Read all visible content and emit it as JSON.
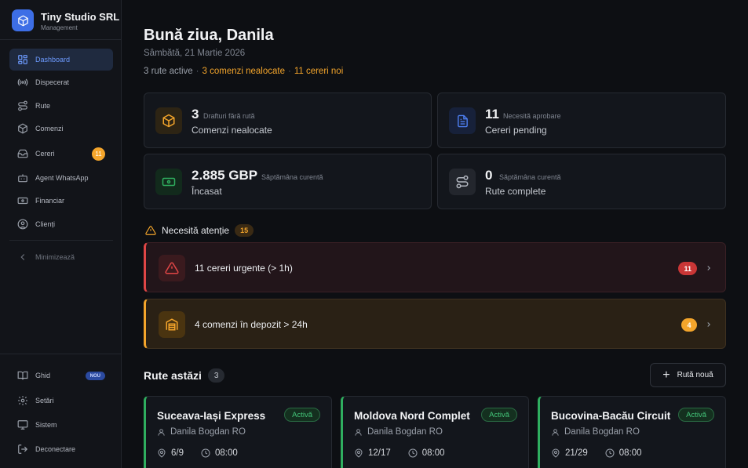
{
  "brand": {
    "name": "Tiny Studio SRL",
    "subtitle": "Management"
  },
  "sidebar": {
    "items": [
      {
        "label": "Dashboard",
        "icon": "grid-icon",
        "active": true
      },
      {
        "label": "Dispecerat",
        "icon": "broadcast-icon"
      },
      {
        "label": "Rute",
        "icon": "route-icon"
      },
      {
        "label": "Comenzi",
        "icon": "package-icon"
      },
      {
        "label": "Cereri",
        "icon": "inbox-icon",
        "badge": "11"
      },
      {
        "label": "Agent WhatsApp",
        "icon": "bot-icon"
      },
      {
        "label": "Financiar",
        "icon": "banknote-icon"
      },
      {
        "label": "Clienți",
        "icon": "user-circle-icon"
      }
    ],
    "collapse_label": "Minimizează",
    "bottom_items": [
      {
        "label": "Ghid",
        "icon": "book-icon",
        "badge": "NOU"
      },
      {
        "label": "Setări",
        "icon": "gear-icon"
      },
      {
        "label": "Sistem",
        "icon": "monitor-icon"
      },
      {
        "label": "Deconectare",
        "icon": "logout-icon"
      }
    ]
  },
  "header": {
    "greeting": "Bună ziua, Danila",
    "date": "Sâmbătă, 21 Martie 2026",
    "summary": {
      "routes": "3 rute active",
      "orders": "3 comenzi nealocate",
      "requests": "11 cereri noi",
      "separator": "·"
    }
  },
  "stats": [
    {
      "value": "3",
      "sub": "Drafturi fără rută",
      "title": "Comenzi nealocate",
      "icon": "package-icon",
      "color": "#f4a52b"
    },
    {
      "value": "11",
      "sub": "Necesită aprobare",
      "title": "Cereri pending",
      "icon": "file-icon",
      "color": "#4d7ef0"
    },
    {
      "value": "2.885 GBP",
      "sub": "Săptămâna curentă",
      "title": "Încasat",
      "icon": "banknote-icon",
      "color": "#2fae5f"
    },
    {
      "value": "0",
      "sub": "Săptămâna curentă",
      "title": "Rute complete",
      "icon": "route-icon",
      "color": "#9aa0aa"
    }
  ],
  "attention": {
    "title": "Necesită atenție",
    "count": "15",
    "alerts": [
      {
        "text": "11 cereri urgente (> 1h)",
        "count": "11",
        "icon": "alert-triangle-icon",
        "color": "#e04646"
      },
      {
        "text": "4 comenzi în depozit > 24h",
        "count": "4",
        "icon": "warehouse-icon",
        "color": "#f4a52b"
      }
    ]
  },
  "routes": {
    "title": "Rute astăzi",
    "count": "3",
    "new_button": "Rută nouă",
    "items": [
      {
        "name": "Suceava-Iași Express",
        "status": "Activă",
        "driver": "Danila Bogdan RO",
        "stops": "6/9",
        "time": "08:00"
      },
      {
        "name": "Moldova Nord Complet",
        "status": "Activă",
        "driver": "Danila Bogdan RO",
        "stops": "12/17",
        "time": "08:00"
      },
      {
        "name": "Bucovina-Bacău Circuit",
        "status": "Activă",
        "driver": "Danila Bogdan RO",
        "stops": "21/29",
        "time": "08:00"
      }
    ]
  },
  "colors": {
    "accent": "#3d6ee6",
    "warning": "#f4a52b",
    "danger": "#e04646",
    "success": "#2fae5f"
  }
}
